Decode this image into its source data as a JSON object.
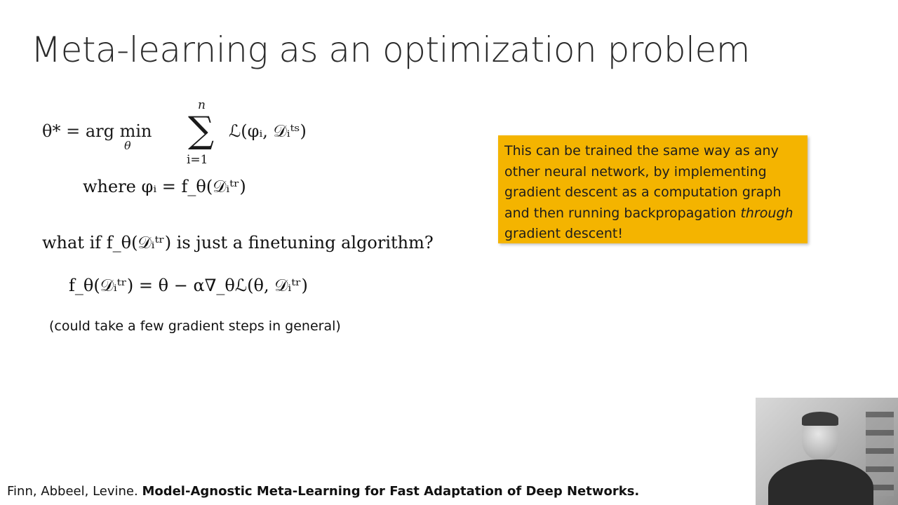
{
  "slide": {
    "title": "Meta-learning as an optimization problem",
    "equations": {
      "objective_left": "θ* = arg min",
      "objective_sub": "θ",
      "sum_upper": "n",
      "sum_lower": "i=1",
      "objective_right": "ℒ(φᵢ, 𝒟ᵢᵗˢ)",
      "where_line": "where φᵢ = f_θ(𝒟ᵢᵗʳ)",
      "whatif_line": "what if f_θ(𝒟ᵢᵗʳ) is just a finetuning algorithm?",
      "update_line": "f_θ(𝒟ᵢᵗʳ) = θ − α∇_θℒ(θ, 𝒟ᵢᵗʳ)"
    },
    "note": "(could take a few gradient steps in general)",
    "callout": {
      "text_before": "This can be trained the same way as any other neural network, by implementing gradient descent as a computation graph and then running backpropagation ",
      "emphasis": "through",
      "text_after": " gradient descent!"
    },
    "citation": {
      "authors": "Finn, Abbeel, Levine. ",
      "paper_title": "Model-Agnostic Meta-Learning for Fast Adaptation of Deep Networks."
    }
  },
  "colors": {
    "callout_bg": "#f4b400",
    "title_text": "#2b2b2b"
  },
  "webcam": {
    "icon": "presenter-video"
  }
}
